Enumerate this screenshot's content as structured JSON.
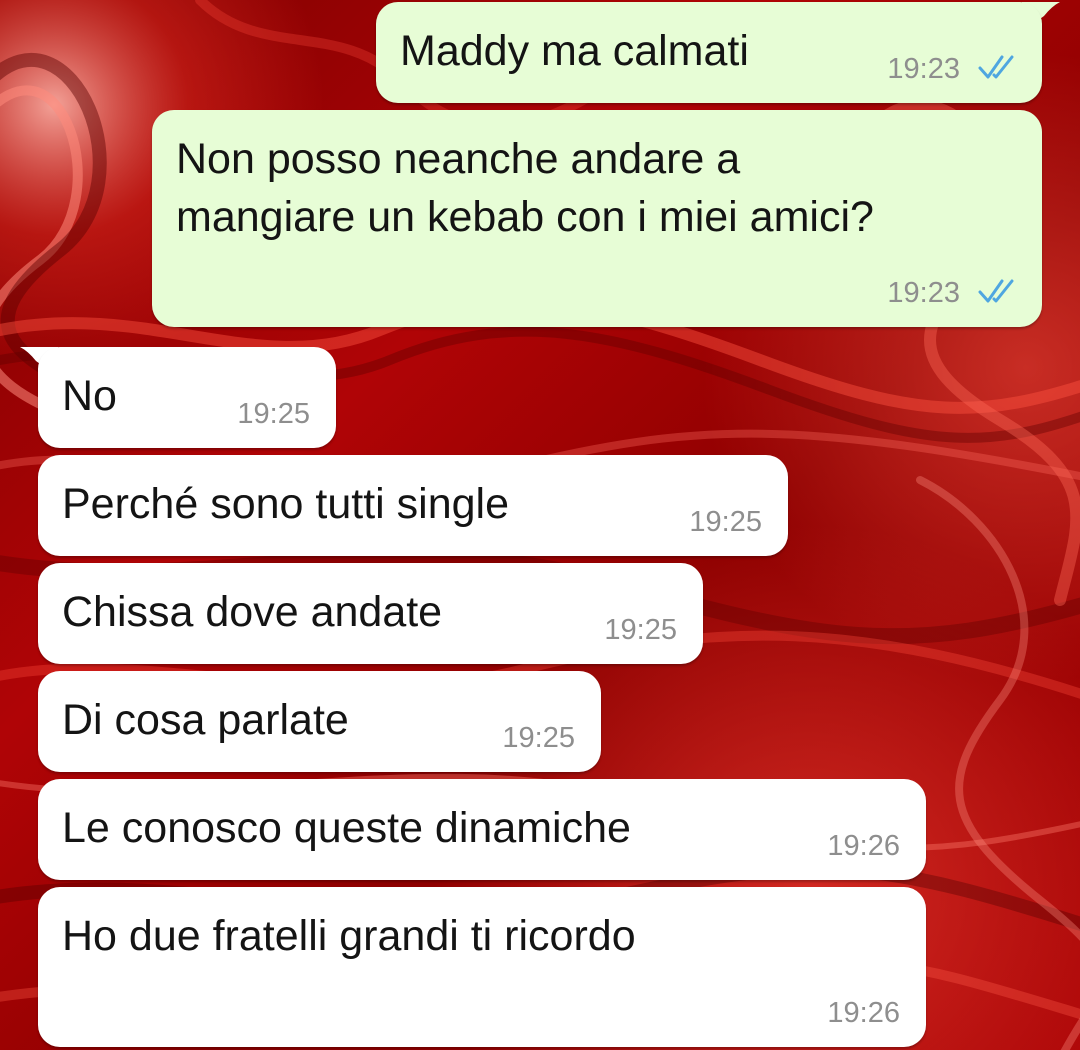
{
  "wallpaper": {
    "colors": [
      "#5a0000",
      "#8a0000",
      "#c4060a",
      "#e8231e",
      "#ff6b5e"
    ]
  },
  "bubble_colors": {
    "outgoing": "#e7fdd6",
    "incoming": "#ffffff",
    "read_ticks": "#4fa6e0"
  },
  "messages": [
    {
      "direction": "outgoing",
      "text": "Maddy ma calmati",
      "time": "19:23",
      "status": "read-double-check-icon"
    },
    {
      "direction": "outgoing",
      "text": "Non posso neanche andare a\nmangiare un kebab con i miei amici?",
      "time": "19:23",
      "status": "read-double-check-icon"
    },
    {
      "direction": "incoming",
      "text": "No",
      "time": "19:25"
    },
    {
      "direction": "incoming",
      "text": "Perché sono tutti single",
      "time": "19:25"
    },
    {
      "direction": "incoming",
      "text": "Chissa dove andate",
      "time": "19:25"
    },
    {
      "direction": "incoming",
      "text": "Di cosa parlate",
      "time": "19:25"
    },
    {
      "direction": "incoming",
      "text": "Le conosco queste dinamiche",
      "time": "19:26"
    },
    {
      "direction": "incoming",
      "text": "Ho due fratelli grandi ti ricordo",
      "time": "19:26"
    }
  ]
}
